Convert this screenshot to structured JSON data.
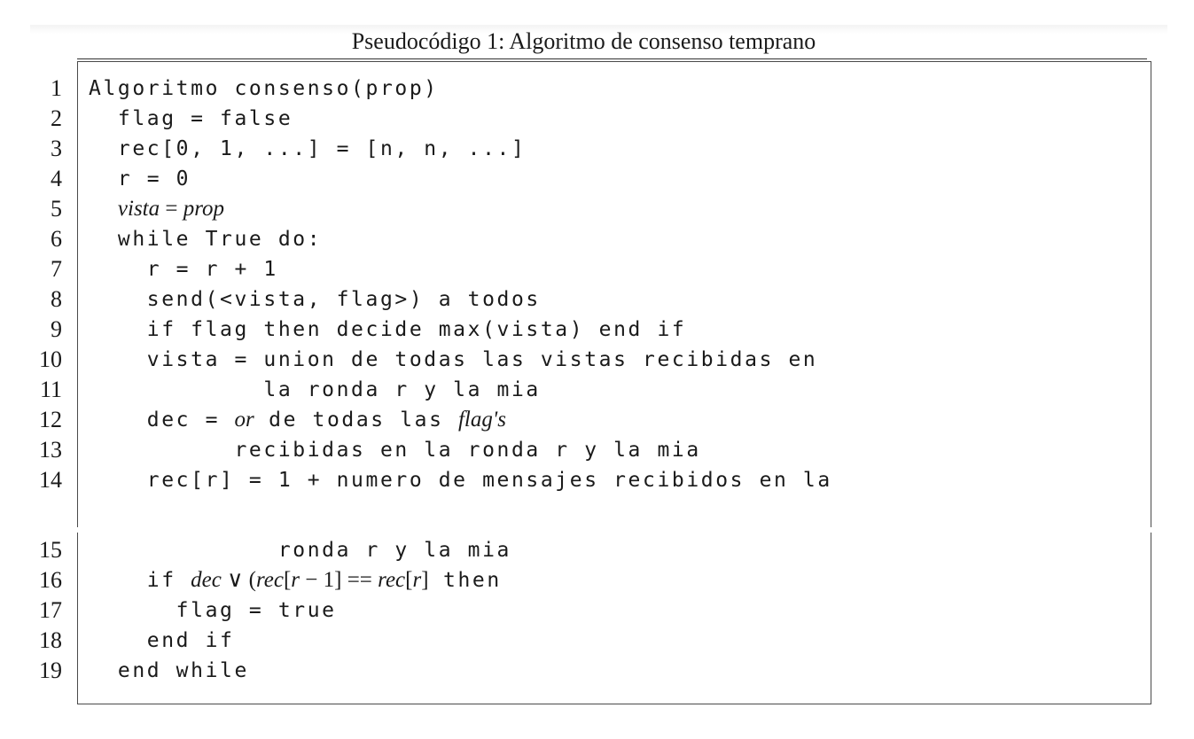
{
  "caption": "Pseudocódigo 1: Algoritmo de consenso temprano",
  "lines": [
    {
      "n": "1",
      "code": "Algoritmo consenso(prop)"
    },
    {
      "n": "2",
      "code": "  flag = false"
    },
    {
      "n": "3",
      "code": "  rec[0, 1, ...] = [n, n, ...]"
    },
    {
      "n": "4",
      "code": "  r = 0"
    },
    {
      "n": "5",
      "pre": "  ",
      "math_lhs": "vista",
      "math_op": " = ",
      "math_rhs": "prop"
    },
    {
      "n": "6",
      "code": "  while True do:"
    },
    {
      "n": "7",
      "code": "    r = r + 1"
    },
    {
      "n": "8",
      "code": "    send(<vista, flag>) a todos"
    },
    {
      "n": "9",
      "code": "    if flag then decide max(vista) end if"
    },
    {
      "n": "10",
      "code": "    vista = union de todas las vistas recibidas en"
    },
    {
      "n": "11",
      "code": "            la ronda r y la mia"
    },
    {
      "n": "12",
      "pre": "    dec = ",
      "math_or": "or",
      "mid": " de todas las ",
      "math_flag": "flag's"
    },
    {
      "n": "13",
      "code": "          recibidas en la ronda r y la mia"
    },
    {
      "n": "14",
      "code": "    rec[r] = 1 + numero de mensajes recibidos en la"
    },
    {
      "n": "15",
      "code": "             ronda r y la mia"
    },
    {
      "n": "16",
      "pre": "    if ",
      "math_cond_a": "dec",
      "math_cond_op": " ∨ (",
      "math_cond_b": "rec",
      "math_cond_c": "[",
      "math_cond_d": "r",
      "math_cond_e": " − 1] == ",
      "math_cond_f": "rec",
      "math_cond_g": "[",
      "math_cond_h": "r",
      "math_cond_i": "]",
      "post": " then"
    },
    {
      "n": "17",
      "code": "      flag = true"
    },
    {
      "n": "18",
      "code": "    end if"
    },
    {
      "n": "19",
      "code": "  end while"
    }
  ]
}
